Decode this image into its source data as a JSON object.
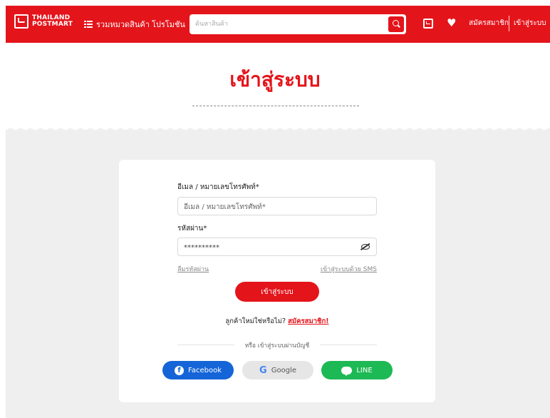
{
  "header": {
    "logo_line1": "THAILAND",
    "logo_line2": "POSTMART",
    "categories_label": "รวมหมวดสินค้า",
    "promotion_label": "โปรโมชัน",
    "search_placeholder": "ค้นหาสินค้า",
    "register_label": "สมัครสมาชิก",
    "login_label": "เข้าสู่ระบบ",
    "accent_color": "#e4141b"
  },
  "page": {
    "title": "เข้าสู่ระบบ"
  },
  "form": {
    "email_label": "อีเมล / หมายเลขโทรศัพท์*",
    "email_placeholder": "อีเมล / หมายเลขโทรศัพท์*",
    "password_label": "รหัสผ่าน*",
    "password_value": "**********",
    "forgot_password": "ลืมรหัสผ่าน",
    "login_sms": "เข้าสู่ระบบด้วย SMS",
    "submit_label": "เข้าสู่ระบบ",
    "new_customer_text": "ลูกค้าใหม่ใช่หรือไม่?",
    "register_link": "สมัครสมาชิก!",
    "or_text": "หรือ เข้าสู่ระบบผ่านบัญชี"
  },
  "social": {
    "facebook": "Facebook",
    "google": "Google",
    "line": "LINE"
  }
}
